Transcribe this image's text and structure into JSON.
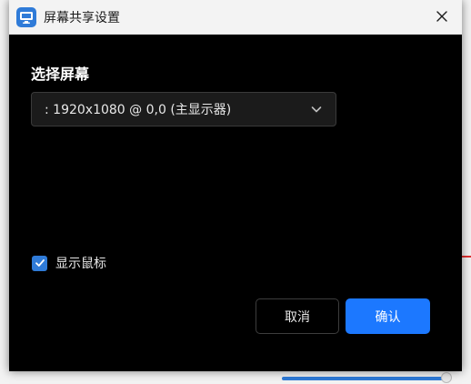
{
  "window": {
    "title": "屏幕共享设置",
    "close_icon": "close-icon",
    "app_icon": "monitor-share-icon"
  },
  "screen_select": {
    "section_title": "选择屏幕",
    "selected_value": ": 1920x1080 @ 0,0 (主显示器)",
    "chevron_icon": "chevron-down-icon"
  },
  "show_cursor": {
    "label": "显示鼠标",
    "checked": true
  },
  "buttons": {
    "cancel_label": "取消",
    "ok_label": "确认"
  },
  "colors": {
    "accent": "#1c78ff",
    "dialog_bg": "#000000",
    "titlebar_bg": "#f3f3f3",
    "select_bg": "#1b1b1b"
  }
}
